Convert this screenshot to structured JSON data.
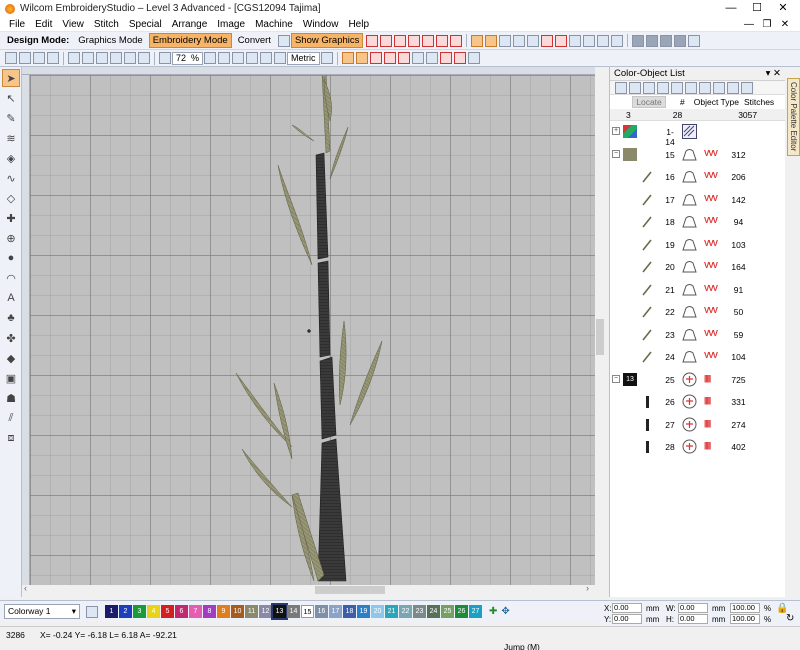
{
  "window": {
    "title": "Wilcom EmbroideryStudio – Level 3 Advanced - [CGS12094        Tajima]",
    "controls": [
      "—",
      "☐",
      "✕"
    ],
    "mdi_controls": [
      "—",
      "❐",
      "✕"
    ]
  },
  "menu": [
    "File",
    "Edit",
    "View",
    "Stitch",
    "Special",
    "Arrange",
    "Image",
    "Machine",
    "Window",
    "Help"
  ],
  "toolbar": {
    "design_mode_label": "Design Mode:",
    "graphics_mode": "Graphics Mode",
    "embroidery_mode": "Embroidery Mode",
    "convert": "Convert",
    "show_graphics": "Show Graphics",
    "zoom_value": "72",
    "zoom_unit": "%",
    "units": "Metric"
  },
  "panel": {
    "title": "Color-Object List",
    "pin": "▾ ✕",
    "headers": {
      "locate": "Locate",
      "num": "#",
      "object_type": "Object Type",
      "stitches": "Stitches"
    },
    "summary": {
      "colors": "3",
      "objects": "28",
      "stitches": "3057"
    },
    "side_tab": "Color Palette Editor",
    "rows": [
      {
        "num": "1-14",
        "stitches": "",
        "expander": "+",
        "kind": "group"
      },
      {
        "num": "15",
        "stitches": "312",
        "expander": "−",
        "color": "#8a8a6a",
        "kind": "satin"
      },
      {
        "num": "16",
        "stitches": "206",
        "kind": "satin",
        "obj": "satin-special"
      },
      {
        "num": "17",
        "stitches": "142",
        "kind": "satin"
      },
      {
        "num": "18",
        "stitches": "94",
        "kind": "satin"
      },
      {
        "num": "19",
        "stitches": "103",
        "kind": "satin"
      },
      {
        "num": "20",
        "stitches": "164",
        "kind": "satin"
      },
      {
        "num": "21",
        "stitches": "91",
        "kind": "satin"
      },
      {
        "num": "22",
        "stitches": "50",
        "kind": "satin"
      },
      {
        "num": "23",
        "stitches": "59",
        "kind": "satin"
      },
      {
        "num": "24",
        "stitches": "104",
        "kind": "satin"
      },
      {
        "num": "25",
        "stitches": "725",
        "expander": "−",
        "color": "#111111",
        "color_num": "13",
        "kind": "tatami"
      },
      {
        "num": "26",
        "stitches": "331",
        "kind": "tatami"
      },
      {
        "num": "27",
        "stitches": "274",
        "kind": "tatami"
      },
      {
        "num": "28",
        "stitches": "402",
        "kind": "tatami"
      }
    ]
  },
  "colorway": {
    "name": "Colorway 1",
    "swatches": [
      {
        "n": "1",
        "c": "#1b1b6e"
      },
      {
        "n": "2",
        "c": "#1e3fbd"
      },
      {
        "n": "3",
        "c": "#1a9a3b"
      },
      {
        "n": "4",
        "c": "#e8d31a"
      },
      {
        "n": "5",
        "c": "#d81d1d"
      },
      {
        "n": "6",
        "c": "#c1286f"
      },
      {
        "n": "7",
        "c": "#e65cb0"
      },
      {
        "n": "8",
        "c": "#a33cc0"
      },
      {
        "n": "9",
        "c": "#e37d1b"
      },
      {
        "n": "10",
        "c": "#a55c1c"
      },
      {
        "n": "11",
        "c": "#8a8a6a"
      },
      {
        "n": "12",
        "c": "#8a8aa6"
      },
      {
        "n": "13",
        "c": "#111111"
      },
      {
        "n": "14",
        "c": "#7a7a7a"
      },
      {
        "n": "15",
        "c": "#ffffff"
      },
      {
        "n": "16",
        "c": "#7f8fa8"
      },
      {
        "n": "17",
        "c": "#8aa4c8"
      },
      {
        "n": "18",
        "c": "#3c5fa8"
      },
      {
        "n": "19",
        "c": "#2a7fc9"
      },
      {
        "n": "20",
        "c": "#8fc7ea"
      },
      {
        "n": "21",
        "c": "#2aa6b8"
      },
      {
        "n": "22",
        "c": "#7aa6b2"
      },
      {
        "n": "23",
        "c": "#7a8a8a"
      },
      {
        "n": "24",
        "c": "#57705a"
      },
      {
        "n": "25",
        "c": "#76a062"
      },
      {
        "n": "26",
        "c": "#1e8a3a"
      },
      {
        "n": "27",
        "c": "#1aa0c4"
      }
    ]
  },
  "coords_panel": {
    "x_label": "X:",
    "x_val": "0.00",
    "x_unit": "mm",
    "y_label": "Y:",
    "y_val": "0.00",
    "y_unit": "mm",
    "w_label": "W:",
    "w_val": "0.00",
    "w_unit": "mm",
    "h_label": "H:",
    "h_val": "0.00",
    "h_unit": "mm",
    "w_pct": "100.00",
    "h_pct": "100.00",
    "pct": "%"
  },
  "status": {
    "stitch_count": "3286",
    "position": "X=  -0.24 Y=   -6.18 L=   6.18 A= -92.21",
    "mode": "Jump (M)"
  }
}
